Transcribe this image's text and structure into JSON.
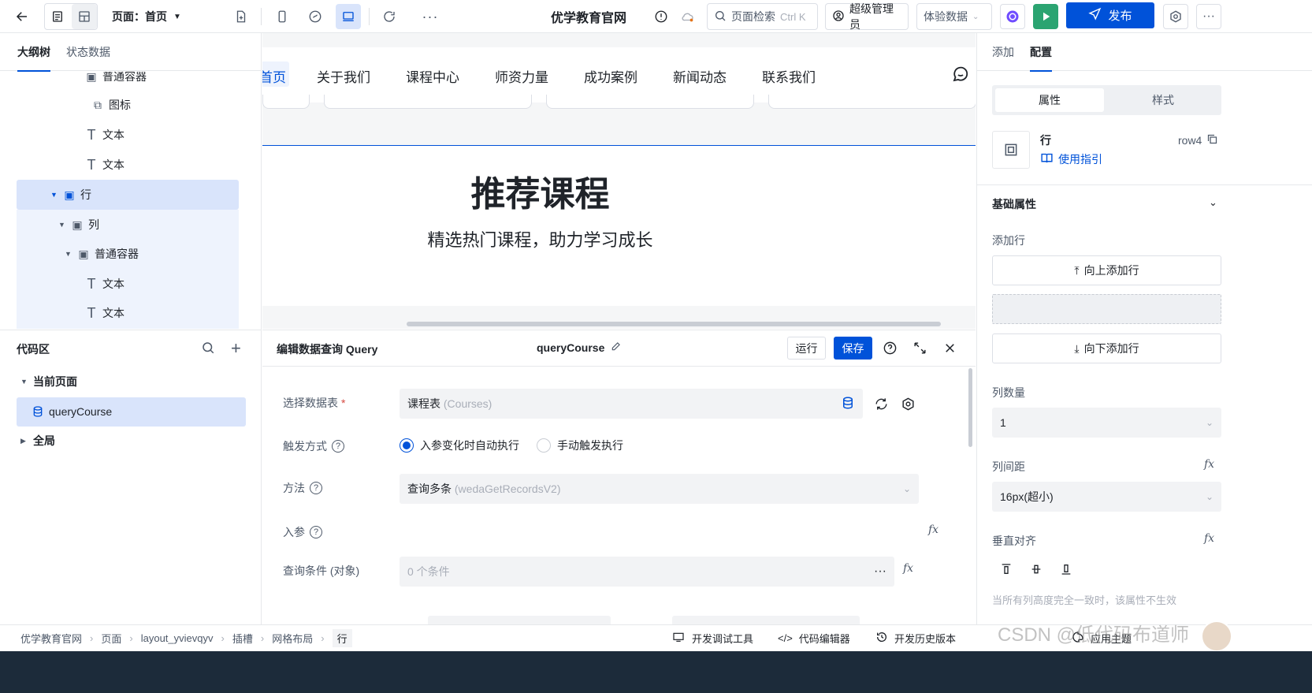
{
  "topbar": {
    "page_label": "页面：首页",
    "app_title": "优学教育官网",
    "search_label": "页面检索",
    "search_shortcut": "Ctrl K",
    "user_label": "超级管理员",
    "data_mode": "体验数据",
    "publish_label": "发布"
  },
  "left": {
    "tabs": [
      "大纲树",
      "状态数据"
    ],
    "tree": [
      {
        "label": "普通容器",
        "icon": "box-icon"
      },
      {
        "label": "图标",
        "icon": "icon-component-icon"
      },
      {
        "label": "文本",
        "icon": "text-icon"
      },
      {
        "label": "文本",
        "icon": "text-icon"
      },
      {
        "label": "行",
        "icon": "box-icon"
      },
      {
        "label": "列",
        "icon": "box-icon"
      },
      {
        "label": "普通容器",
        "icon": "box-icon"
      },
      {
        "label": "文本",
        "icon": "text-icon"
      },
      {
        "label": "文本",
        "icon": "text-icon"
      }
    ],
    "code": {
      "title": "代码区",
      "current_page": "当前页面",
      "query": "queryCourse",
      "global": "全局"
    }
  },
  "canvas": {
    "nav": [
      "首页",
      "关于我们",
      "课程中心",
      "师资力量",
      "成功案例",
      "新闻动态",
      "联系我们"
    ],
    "heading": "推荐课程",
    "subheading": "精选热门课程，助力学习成长"
  },
  "query": {
    "title": "编辑数据查询 Query",
    "name": "queryCourse",
    "run": "运行",
    "save": "保存",
    "table_label": "选择数据表",
    "table_value": "课程表",
    "table_hint": "(Courses)",
    "trigger_label": "触发方式",
    "trigger_auto": "入参变化时自动执行",
    "trigger_manual": "手动触发执行",
    "method_label": "方法",
    "method_value": "查询多条",
    "method_hint": "(wedaGetRecordsV2)",
    "params_label": "入参",
    "cond_label": "查询条件 (对象)",
    "cond_value": "0 个条件"
  },
  "right": {
    "tabs": [
      "添加",
      "配置"
    ],
    "seg": [
      "属性",
      "样式"
    ],
    "comp_name": "行",
    "comp_id": "row4",
    "guide": "使用指引",
    "basic": "基础属性",
    "add_row": "添加行",
    "add_up": "向上添加行",
    "add_down": "向下添加行",
    "col_count_label": "列数量",
    "col_count": "1",
    "col_gap_label": "列间距",
    "col_gap": "16px(超小)",
    "valign_label": "垂直对齐",
    "note": "当所有列高度完全一致时，该属性不生效"
  },
  "bottom": {
    "breadcrumb": [
      "优学教育官网",
      "页面",
      "layout_yvievqyv",
      "插槽",
      "网格布局",
      "行"
    ],
    "tools": [
      "开发调试工具",
      "代码编辑器",
      "开发历史版本",
      "应用主题"
    ],
    "watermark": "CSDN @低代码布道师"
  },
  "colors": {
    "accent": "#0052d9",
    "run_green": "#2ba471",
    "selected_bg": "#d9e4fb"
  }
}
